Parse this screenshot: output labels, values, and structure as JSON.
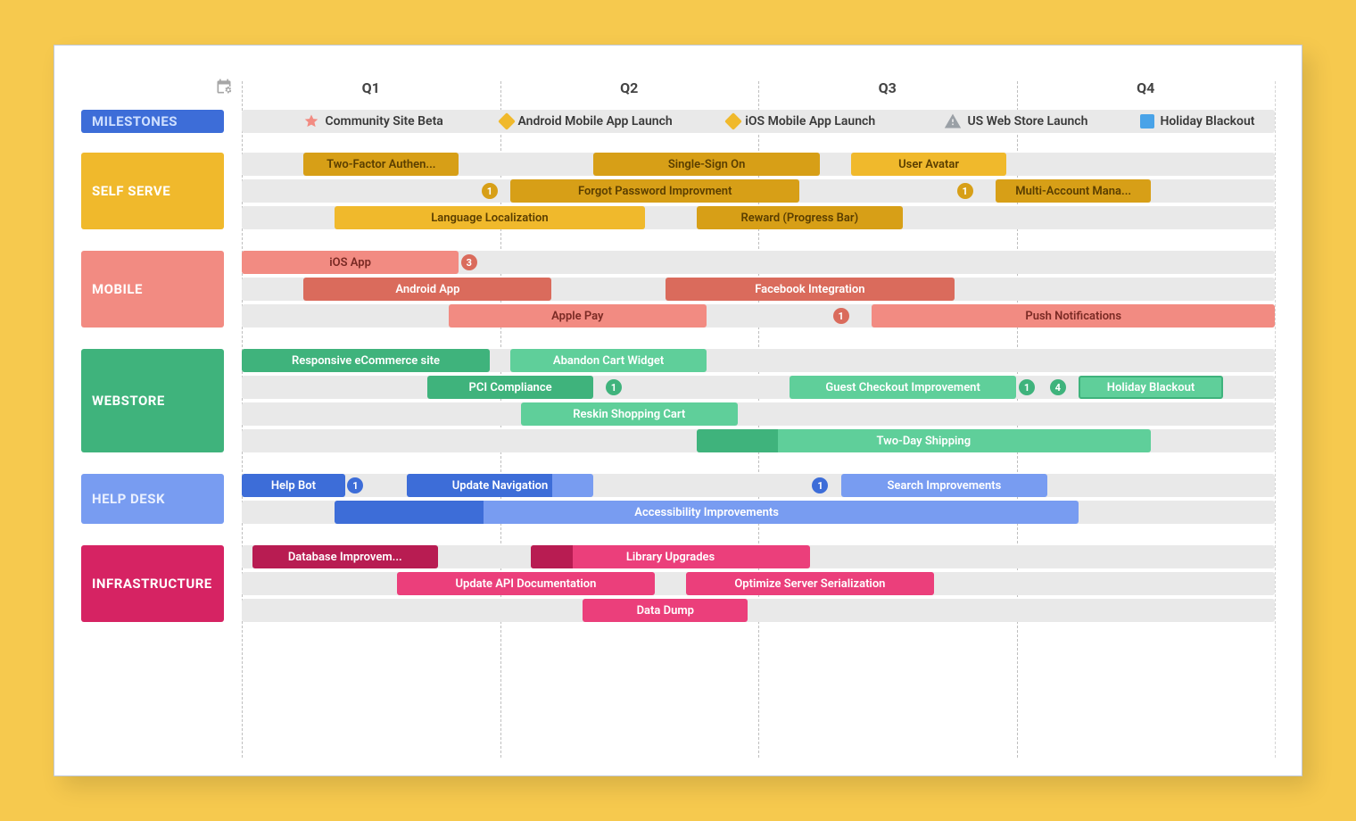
{
  "chart_data": {
    "type": "gantt",
    "x_axis": {
      "categories": [
        "Q1",
        "Q2",
        "Q3",
        "Q4"
      ],
      "unit_percent_per_quarter": 25
    },
    "milestones": [
      {
        "label": "Community Site Beta",
        "quarter": 1,
        "pos_pct": 6,
        "icon": "star",
        "color": "#f28b82"
      },
      {
        "label": "Android Mobile App Launch",
        "quarter": 2,
        "pos_pct": 25,
        "icon": "diamond",
        "color": "#f0b92c"
      },
      {
        "label": "iOS Mobile App Launch",
        "quarter": 3,
        "pos_pct": 47,
        "icon": "diamond",
        "color": "#f0b92c"
      },
      {
        "label": "US Web Store Launch",
        "quarter": 4,
        "pos_pct": 68,
        "icon": "warning",
        "color": "#9aa0a6"
      },
      {
        "label": "Holiday Blackout",
        "quarter": 4,
        "pos_pct": 87,
        "icon": "square",
        "color": "#49a3e8"
      }
    ],
    "groups": [
      {
        "name": "SELF SERVE",
        "color": "#f0b92c",
        "rows": [
          [
            {
              "label": "Two-Factor Authen...",
              "start_pct": 6,
              "width_pct": 15,
              "shade": "dark"
            },
            {
              "label": "Single-Sign On",
              "start_pct": 34,
              "width_pct": 22,
              "shade": "dark"
            },
            {
              "label": "User Avatar",
              "start_pct": 59,
              "width_pct": 15,
              "shade": "light"
            }
          ],
          [
            {
              "badge": 1,
              "at_pct": 24
            },
            {
              "label": "Forgot Password Improvment",
              "start_pct": 26,
              "width_pct": 28,
              "shade": "dark"
            },
            {
              "badge": 1,
              "at_pct": 70
            },
            {
              "label": "Multi-Account Mana...",
              "start_pct": 73,
              "width_pct": 15,
              "shade": "dark"
            }
          ],
          [
            {
              "label": "Language Localization",
              "start_pct": 9,
              "width_pct": 30,
              "shade": "light"
            },
            {
              "label": "Reward (Progress Bar)",
              "start_pct": 44,
              "width_pct": 20,
              "shade": "dark"
            }
          ]
        ]
      },
      {
        "name": "MOBILE",
        "color": "#f28b82",
        "rows": [
          [
            {
              "label": "iOS App",
              "start_pct": 0,
              "width_pct": 21,
              "shade": "light"
            },
            {
              "badge": 3,
              "at_pct": 22
            }
          ],
          [
            {
              "label": "Android App",
              "start_pct": 6,
              "width_pct": 24,
              "shade": "dark"
            },
            {
              "label": "Facebook Integration",
              "start_pct": 41,
              "width_pct": 28,
              "shade": "dark"
            }
          ],
          [
            {
              "label": "Apple Pay",
              "start_pct": 20,
              "width_pct": 25,
              "shade": "light"
            },
            {
              "badge": 1,
              "at_pct": 58
            },
            {
              "label": "Push Notifications",
              "start_pct": 61,
              "width_pct": 39,
              "shade": "light"
            }
          ]
        ]
      },
      {
        "name": "WEBSTORE",
        "color": "#3fb37c",
        "rows": [
          [
            {
              "label": "Responsive eCommerce site",
              "start_pct": 0,
              "width_pct": 24,
              "shade": "dark"
            },
            {
              "label": "Abandon Cart Widget",
              "start_pct": 26,
              "width_pct": 19,
              "shade": "light"
            }
          ],
          [
            {
              "label": "PCI Compliance",
              "start_pct": 18,
              "width_pct": 16,
              "shade": "dark"
            },
            {
              "badge": 1,
              "at_pct": 36
            },
            {
              "label": "Guest Checkout Improvement",
              "start_pct": 53,
              "width_pct": 22,
              "shade": "light"
            },
            {
              "badge": 1,
              "at_pct": 76
            },
            {
              "badge": 4,
              "at_pct": 79
            },
            {
              "label": "Holiday Blackout",
              "start_pct": 81,
              "width_pct": 14,
              "shade": "bordered"
            }
          ],
          [
            {
              "label": "Reskin Shopping Cart",
              "start_pct": 27,
              "width_pct": 21,
              "shade": "light"
            }
          ],
          [
            {
              "label": "Two-Day Shipping",
              "start_pct": 44,
              "width_pct": 44,
              "shade": "light",
              "progress_pct": 18
            }
          ]
        ]
      },
      {
        "name": "HELP DESK",
        "color": "#789cf1",
        "rows": [
          [
            {
              "label": "Help Bot",
              "start_pct": 0,
              "width_pct": 10,
              "shade": "dark"
            },
            {
              "badge": 1,
              "at_pct": 11
            },
            {
              "label": "Update Navigation",
              "start_pct": 16,
              "width_pct": 18,
              "shade": "dark",
              "progress_pct": 78
            },
            {
              "badge": 1,
              "at_pct": 56
            },
            {
              "label": "Search Improvements",
              "start_pct": 58,
              "width_pct": 20,
              "shade": "light"
            }
          ],
          [
            {
              "label": "Accessibility Improvements",
              "start_pct": 9,
              "width_pct": 72,
              "shade": "light",
              "progress_pct": 20
            }
          ]
        ]
      },
      {
        "name": "INFRASTRUCTURE",
        "color": "#d62363",
        "rows": [
          [
            {
              "label": "Database Improvem...",
              "start_pct": 1,
              "width_pct": 18,
              "shade": "dark"
            },
            {
              "label": "Library Upgrades",
              "start_pct": 28,
              "width_pct": 27,
              "shade": "light",
              "progress_pct": 15
            }
          ],
          [
            {
              "label": "Update API Documentation",
              "start_pct": 15,
              "width_pct": 25,
              "shade": "light"
            },
            {
              "label": "Optimize Server Serialization",
              "start_pct": 43,
              "width_pct": 24,
              "shade": "light"
            }
          ],
          [
            {
              "label": "Data Dump",
              "start_pct": 33,
              "width_pct": 16,
              "shade": "light"
            }
          ]
        ]
      }
    ]
  },
  "header": {
    "categories": [
      "Q1",
      "Q2",
      "Q3",
      "Q4"
    ]
  },
  "labels": {
    "milestones": "MILESTONES",
    "selfserve": "SELF SERVE",
    "mobile": "MOBILE",
    "webstore": "WEBSTORE",
    "helpdesk": "HELP DESK",
    "infra": "INFRASTRUCTURE"
  }
}
